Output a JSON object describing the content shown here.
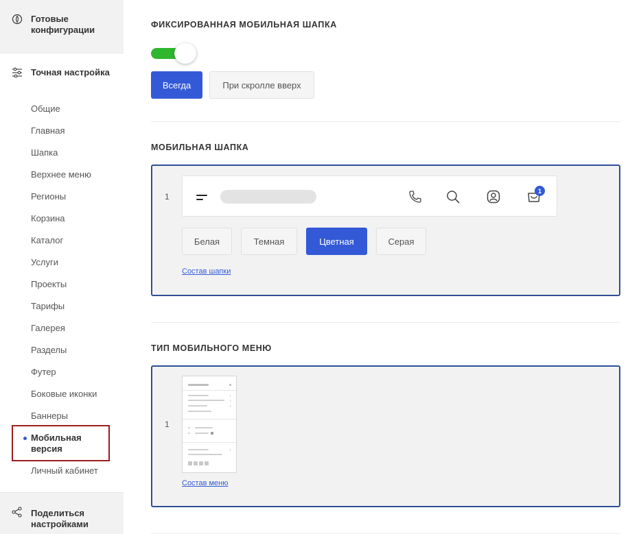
{
  "sidebar": {
    "top_block": {
      "label": "Готовые конфигурации",
      "icon": "palette-icon"
    },
    "fine_tune": {
      "label": "Точная настройка",
      "icon": "sliders-icon"
    },
    "items": [
      {
        "label": "Общие"
      },
      {
        "label": "Главная"
      },
      {
        "label": "Шапка"
      },
      {
        "label": "Верхнее меню"
      },
      {
        "label": "Регионы"
      },
      {
        "label": "Корзина"
      },
      {
        "label": "Каталог"
      },
      {
        "label": "Услуги"
      },
      {
        "label": "Проекты"
      },
      {
        "label": "Тарифы"
      },
      {
        "label": "Галерея"
      },
      {
        "label": "Разделы"
      },
      {
        "label": "Футер"
      },
      {
        "label": "Боковые иконки"
      },
      {
        "label": "Баннеры"
      }
    ],
    "active_item": {
      "label": "Мобильная версия"
    },
    "after_item": {
      "label": "Личный кабинет"
    },
    "bottom_block": {
      "label": "Поделиться настройками",
      "icon": "share-icon"
    }
  },
  "fixed_header": {
    "title": "ФИКСИРОВАННАЯ МОБИЛЬНАЯ ШАПКА",
    "toggle_on": true,
    "options": [
      {
        "label": "Всегда",
        "selected": true
      },
      {
        "label": "При скролле вверх",
        "selected": false
      }
    ]
  },
  "mobile_header": {
    "title": "МОБИЛЬНАЯ ШАПКА",
    "index": "1",
    "cart_count": "1",
    "styles": [
      {
        "label": "Белая",
        "selected": false
      },
      {
        "label": "Темная",
        "selected": false
      },
      {
        "label": "Цветная",
        "selected": true
      },
      {
        "label": "Серая",
        "selected": false
      }
    ],
    "link": "Состав шапки"
  },
  "mobile_menu": {
    "title": "ТИП МОБИЛЬНОГО МЕНЮ",
    "index": "1",
    "link": "Состав меню"
  },
  "colors": {
    "accent": "#3359d6",
    "toggle_on": "#2fb62f",
    "active_outline": "#9b1c1c",
    "panel_border": "#2e4f96"
  }
}
